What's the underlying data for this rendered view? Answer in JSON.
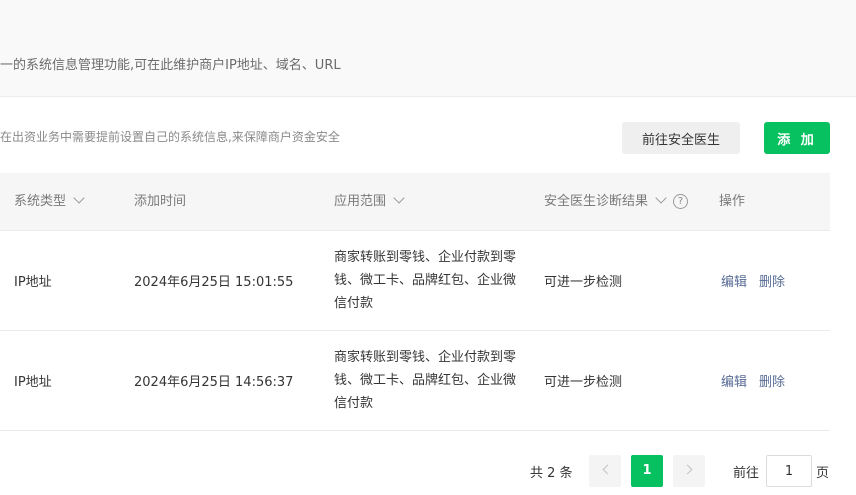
{
  "header": {
    "description": "一的系统信息管理功能,可在此维护商户IP地址、域名、URL"
  },
  "toolbar": {
    "note": "在出资业务中需要提前设置自己的系统信息,来保障商户资金安全",
    "doctor_label": "前往安全医生",
    "add_label": "添 加"
  },
  "table": {
    "columns": {
      "system_type": "系统类型",
      "added_time": "添加时间",
      "scope": "应用范围",
      "diagnosis": "安全医生诊断结果",
      "actions": "操作"
    },
    "rows": [
      {
        "system_type": "IP地址",
        "added_time": "2024年6月25日 15:01:55",
        "scope": "商家转账到零钱、企业付款到零钱、微工卡、品牌红包、企业微信付款",
        "diagnosis": "可进一步检测",
        "edit": "编辑",
        "delete": "删除"
      },
      {
        "system_type": "IP地址",
        "added_time": "2024年6月25日 14:56:37",
        "scope": "商家转账到零钱、企业付款到零钱、微工卡、品牌红包、企业微信付款",
        "diagnosis": "可进一步检测",
        "edit": "编辑",
        "delete": "删除"
      }
    ]
  },
  "pagination": {
    "total": "共 2 条",
    "current_page": "1",
    "goto_label": "前往",
    "goto_value": "1",
    "goto_suffix": "页"
  },
  "colors": {
    "accent": "#07c160",
    "link": "#576b95"
  },
  "icons": {
    "sort": "chevron-down-icon",
    "help": "question-circle-icon",
    "prev": "chevron-left-icon",
    "next": "chevron-right-icon"
  }
}
